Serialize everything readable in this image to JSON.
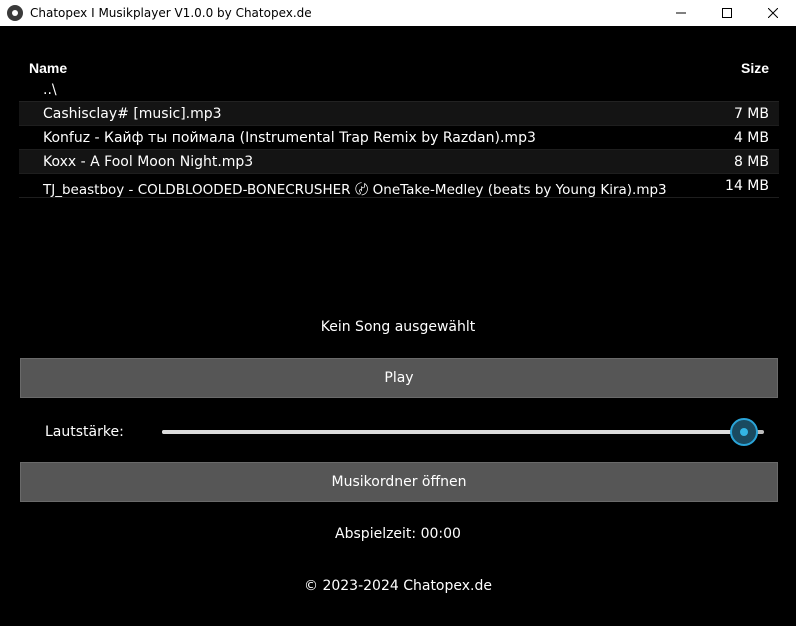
{
  "window": {
    "title": "Chatopex I Musikplayer V1.0.0 by Chatopex.de"
  },
  "filelist": {
    "columns": {
      "name": "Name",
      "size": "Size"
    },
    "parent_entry": "..\\",
    "files": [
      {
        "name": "Cashisclay# [music].mp3",
        "size": "7 MB"
      },
      {
        "name": "Konfuz - Кайф ты поймала (Instrumental Trap Remix by Razdan).mp3",
        "size": "4 MB"
      },
      {
        "name": "Koxx - A Fool Moon Night.mp3",
        "size": "8 MB"
      },
      {
        "name": "TJ_beastboy - COLDBLOODED-BONECRUSHER 〄 OneTake-Medley (beats by Young Kira).mp3",
        "size": "14 MB"
      }
    ]
  },
  "status_text": "Kein Song ausgewählt",
  "play_button": "Play",
  "volume": {
    "label": "Lautstärke:",
    "value": 1.0
  },
  "folder_button": "Musikordner öffnen",
  "playtime": "Abspielzeit: 00:00",
  "footer": "© 2023-2024 Chatopex.de",
  "colors": {
    "accent": "#33b5e5",
    "button_bg": "#565656",
    "background": "#000000"
  },
  "icons": {
    "app": "app-logo-icon",
    "minimize": "minimize-icon",
    "maximize": "maximize-icon",
    "close": "close-icon"
  }
}
